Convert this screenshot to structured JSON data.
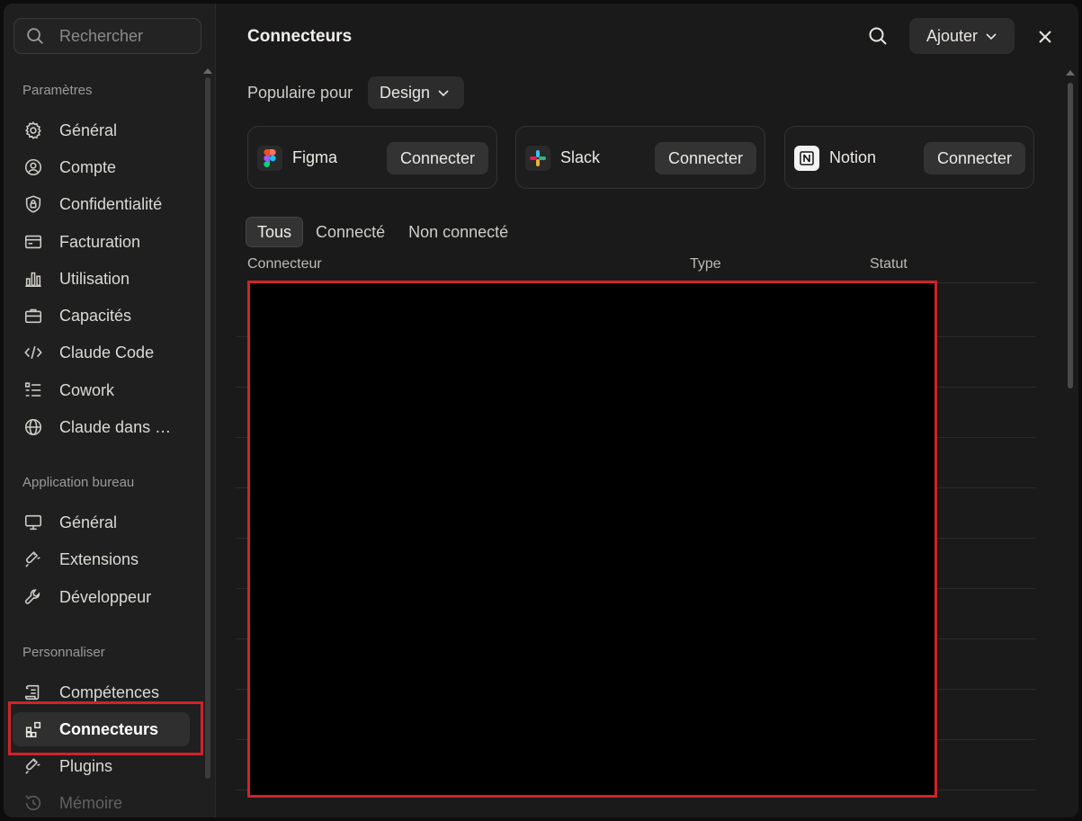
{
  "sidebar": {
    "search_placeholder": "Rechercher",
    "sections": [
      {
        "title": "Paramètres",
        "items": [
          {
            "label": "Général",
            "icon": "gear-icon"
          },
          {
            "label": "Compte",
            "icon": "user-circle-icon"
          },
          {
            "label": "Confidentialité",
            "icon": "shield-lock-icon"
          },
          {
            "label": "Facturation",
            "icon": "credit-card-icon"
          },
          {
            "label": "Utilisation",
            "icon": "bar-chart-icon"
          },
          {
            "label": "Capacités",
            "icon": "briefcase-icon"
          },
          {
            "label": "Claude Code",
            "icon": "code-icon"
          },
          {
            "label": "Cowork",
            "icon": "checklist-icon"
          },
          {
            "label": "Claude dans …",
            "icon": "globe-icon"
          }
        ]
      },
      {
        "title": "Application bureau",
        "items": [
          {
            "label": "Général",
            "icon": "monitor-icon"
          },
          {
            "label": "Extensions",
            "icon": "plug-icon"
          },
          {
            "label": "Développeur",
            "icon": "wrench-icon"
          }
        ]
      },
      {
        "title": "Personnaliser",
        "items": [
          {
            "label": "Compétences",
            "icon": "scroll-icon"
          },
          {
            "label": "Connecteurs",
            "icon": "connectors-icon",
            "active": true
          },
          {
            "label": "Plugins",
            "icon": "plug-icon"
          },
          {
            "label": "Mémoire",
            "icon": "history-icon"
          }
        ]
      }
    ]
  },
  "main": {
    "title": "Connecteurs",
    "add_label": "Ajouter",
    "popular_label": "Populaire pour",
    "popular_value": "Design",
    "cards": [
      {
        "name": "Figma",
        "action": "Connecter",
        "icon": "figma-icon"
      },
      {
        "name": "Slack",
        "action": "Connecter",
        "icon": "slack-icon"
      },
      {
        "name": "Notion",
        "action": "Connecter",
        "icon": "notion-icon"
      }
    ],
    "tabs": [
      "Tous",
      "Connecté",
      "Non connecté"
    ],
    "columns": [
      "Connecteur",
      "Type",
      "Statut"
    ]
  },
  "colors": {
    "highlight": "#d0232a",
    "background": "#1a1a1a"
  }
}
